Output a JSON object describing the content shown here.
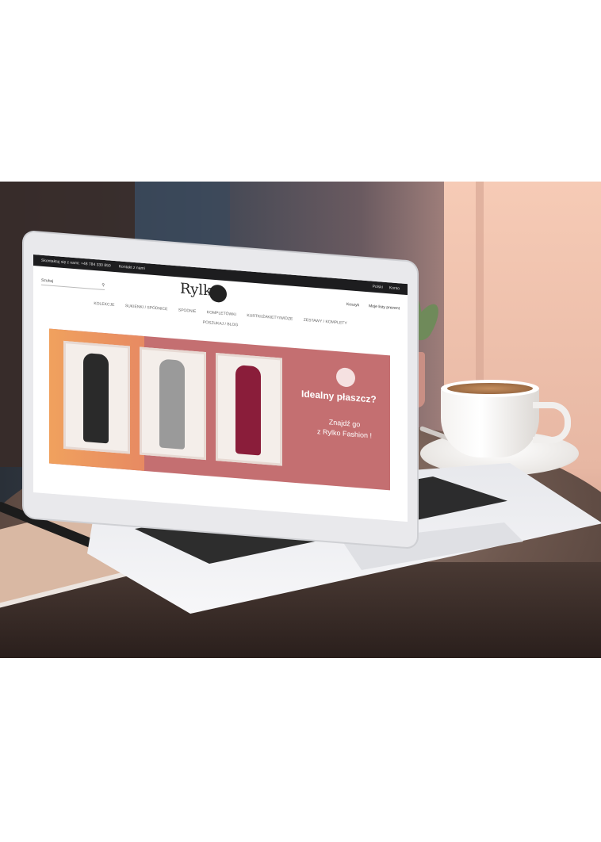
{
  "site": {
    "topbar": {
      "phone": "Skontaktuj się z nami: +48 784 330 850",
      "contact": "Kontakt z nami",
      "lang": "Polski",
      "account": "Konto"
    },
    "search_placeholder": "Szukaj",
    "logo_text": "Rylko",
    "account_links": [
      "Koszyk",
      "Moje listy prezent"
    ],
    "nav": [
      "KOLEKCJE",
      "SUKIENKI / SPÓDNICE",
      "SPODNIE",
      "KOMPLETÓWKI",
      "KURTKI/ŻAKIETY/WIDZE",
      "ZESTAWY / KOMPLETY",
      "POSZUKAJ / BLOG"
    ],
    "banner": {
      "title": "Idealny płaszcz?",
      "subtitle_line1": "Znajdź go",
      "subtitle_line2": "z Rylko Fashion !"
    }
  },
  "colors": {
    "banner": "#c46f71",
    "accent_left": "#f0a15e",
    "coat_dark": "#2a2a2a",
    "coat_grey": "#9a9a9a",
    "coat_burgundy": "#8a1d3a"
  }
}
